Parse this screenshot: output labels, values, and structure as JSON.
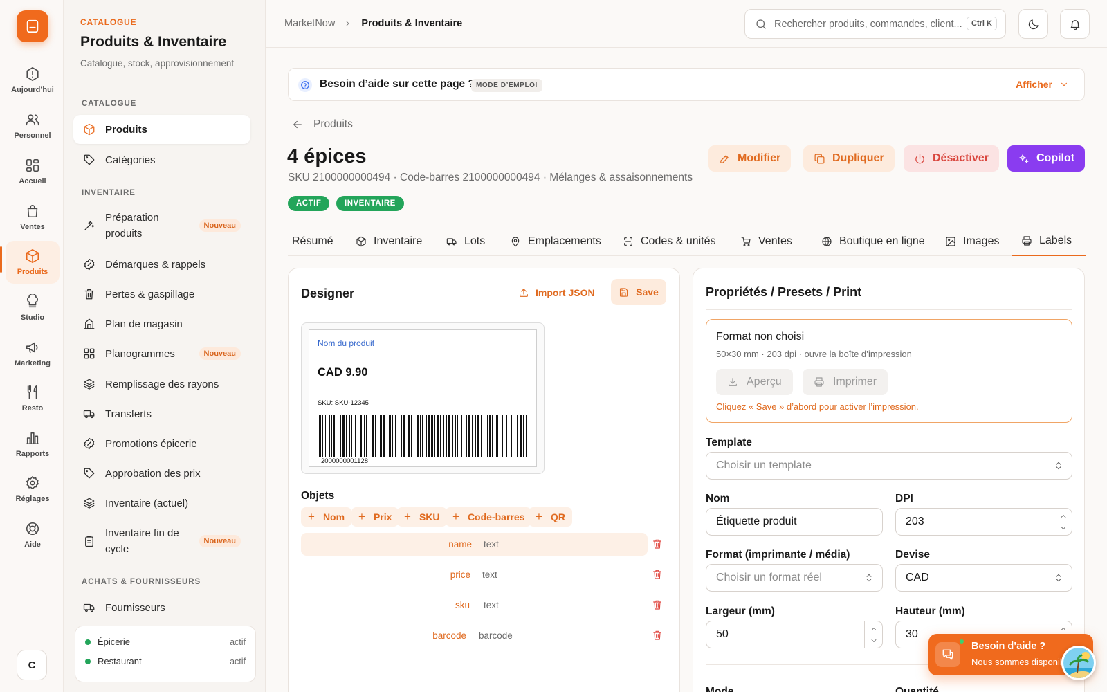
{
  "rail": {
    "items": [
      {
        "label": "Aujourd’hui",
        "icon": "alert-circle-icon"
      },
      {
        "label": "Personnel",
        "icon": "users-icon"
      },
      {
        "label": "Accueil",
        "icon": "grid-icon"
      },
      {
        "label": "Ventes",
        "icon": "bag-icon"
      },
      {
        "label": "Produits",
        "icon": "box-icon",
        "active": true
      },
      {
        "label": "Studio",
        "icon": "chef-hat-icon"
      },
      {
        "label": "Marketing",
        "icon": "megaphone-icon"
      },
      {
        "label": "Resto",
        "icon": "utensils-icon"
      },
      {
        "label": "Rapports",
        "icon": "bar-chart-icon"
      },
      {
        "label": "Réglages",
        "icon": "gear-icon"
      },
      {
        "label": "Aide",
        "icon": "lifebuoy-icon"
      }
    ],
    "avatar": "C"
  },
  "sidebar": {
    "kicker": "CATALOGUE",
    "title": "Produits & Inventaire",
    "subtitle": "Catalogue, stock, approvisionnement",
    "sections": {
      "catalogue": "CATALOGUE",
      "inventaire": "INVENTAIRE",
      "achats": "ACHATS & FOURNISSEURS"
    },
    "items": [
      {
        "label": "Produits",
        "active": true
      },
      {
        "label": "Catégories"
      },
      {
        "label": "Préparation produits",
        "badge": "Nouveau"
      },
      {
        "label": "Démarques & rappels"
      },
      {
        "label": "Pertes & gaspillage"
      },
      {
        "label": "Plan de magasin"
      },
      {
        "label": "Planogrammes",
        "badge": "Nouveau"
      },
      {
        "label": "Remplissage des rayons"
      },
      {
        "label": "Transferts"
      },
      {
        "label": "Promotions épicerie"
      },
      {
        "label": "Approbation des prix"
      },
      {
        "label": "Inventaire (actuel)"
      },
      {
        "label": "Inventaire fin de cycle",
        "badge": "Nouveau"
      },
      {
        "label": "Fournisseurs"
      }
    ],
    "status": [
      {
        "name": "Épicerie",
        "state": "actif"
      },
      {
        "name": "Restaurant",
        "state": "actif"
      }
    ]
  },
  "topbar": {
    "breadcrumb_root": "MarketNow",
    "breadcrumb_current": "Produits & Inventaire",
    "search_placeholder": "Rechercher produits, commandes, client...",
    "shortcut": "Ctrl K"
  },
  "help": {
    "title": "Besoin d’aide sur cette page ?",
    "tag": "MODE D’EMPLOI",
    "toggle": "Afficher"
  },
  "product": {
    "back": "Produits",
    "title": "4 épices",
    "meta": "SKU 2100000000494 · Code-barres 2100000000494 · Mélanges & assaisonnements",
    "badges": [
      "ACTIF",
      "INVENTAIRE"
    ],
    "actions": {
      "edit": "Modifier",
      "duplicate": "Dupliquer",
      "deactivate": "Désactiver",
      "copilot": "Copilot"
    }
  },
  "tabs": [
    "Résumé",
    "Inventaire",
    "Lots",
    "Emplacements",
    "Codes & unités",
    "Ventes",
    "Boutique en ligne",
    "Images",
    "Labels"
  ],
  "designer": {
    "title": "Designer",
    "import": "Import JSON",
    "save": "Save",
    "label_preview": {
      "name": "Nom du produit",
      "price": "CAD 9.90",
      "sku": "SKU: SKU-12345",
      "barcode": "2000000001128"
    },
    "objects_title": "Objets",
    "add_chips": [
      "Nom",
      "Prix",
      "SKU",
      "Code-barres",
      "QR"
    ],
    "objects": [
      {
        "key": "name",
        "type": "text"
      },
      {
        "key": "price",
        "type": "text"
      },
      {
        "key": "sku",
        "type": "text"
      },
      {
        "key": "barcode",
        "type": "barcode"
      }
    ]
  },
  "properties": {
    "title": "Propriétés / Presets / Print",
    "format_title": "Format non choisi",
    "format_sub": "50×30 mm · 203 dpi · ouvre la boîte d’impression",
    "preview": "Aperçu",
    "print": "Imprimer",
    "warning": "Cliquez « Save » d’abord pour activer l’impression.",
    "template_label": "Template",
    "template_placeholder": "Choisir un template",
    "name_label": "Nom",
    "name_value": "Étiquette produit",
    "dpi_label": "DPI",
    "dpi_value": "203",
    "format_label": "Format (imprimante / média)",
    "format_placeholder": "Choisir un format réel",
    "currency_label": "Devise",
    "currency_value": "CAD",
    "width_label": "Largeur (mm)",
    "width_value": "50",
    "height_label": "Hauteur (mm)",
    "height_value": "30",
    "mode_label": "Mode",
    "qty_label": "Quantité"
  },
  "chat": {
    "title": "Besoin d’aide ?",
    "sub": "Nous sommes disponibles"
  },
  "colors": {
    "accent": "#ea6a1d",
    "success": "#23a55a",
    "copilot": "#8a3cf0",
    "danger": "#d9463e"
  }
}
